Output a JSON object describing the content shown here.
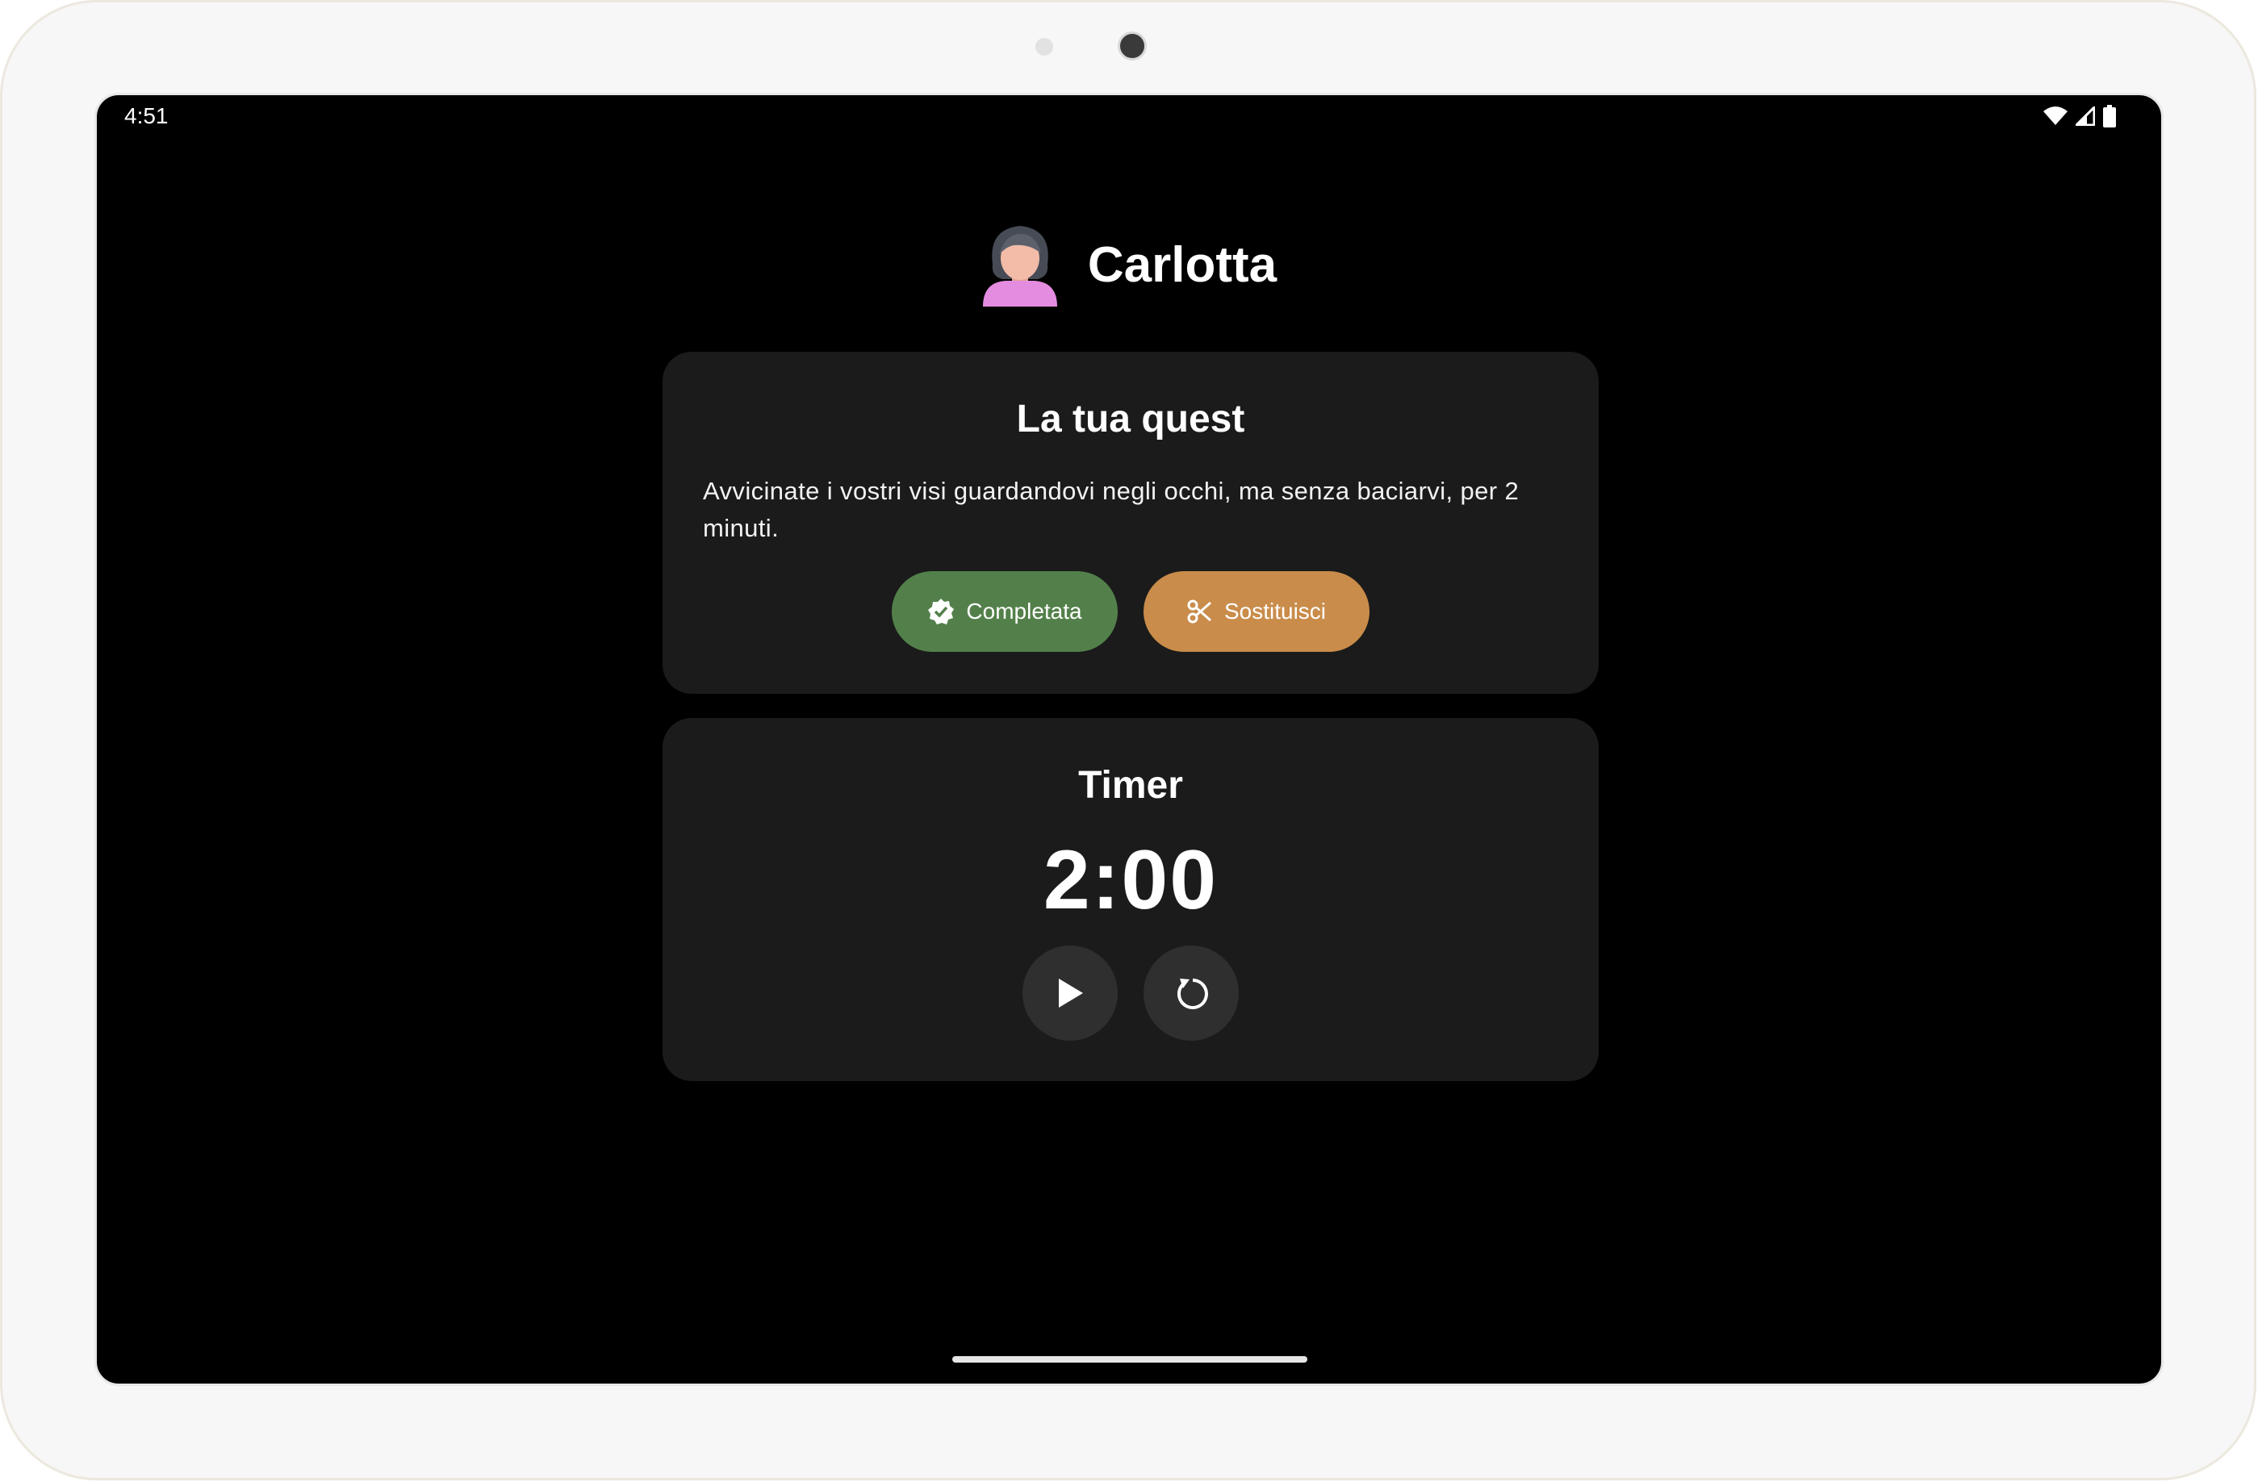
{
  "status_bar": {
    "time": "4:51",
    "icons": [
      "wifi-icon",
      "signal-icon",
      "battery-icon"
    ]
  },
  "header": {
    "avatar": "woman-avatar-icon",
    "name": "Carlotta"
  },
  "quest": {
    "title": "La tua quest",
    "text": "Avvicinate i vostri visi guardandovi negli occhi, ma senza baciarvi, per 2 minuti.",
    "complete_label": "Completata",
    "replace_label": "Sostituisci"
  },
  "timer": {
    "title": "Timer",
    "display": "2:00",
    "play_icon": "play-icon",
    "reset_icon": "reset-icon"
  },
  "colors": {
    "background": "#000000",
    "card": "#1b1b1b",
    "complete_button": "#53804a",
    "replace_button": "#c98c4a",
    "round_button": "#2f2f2f"
  }
}
